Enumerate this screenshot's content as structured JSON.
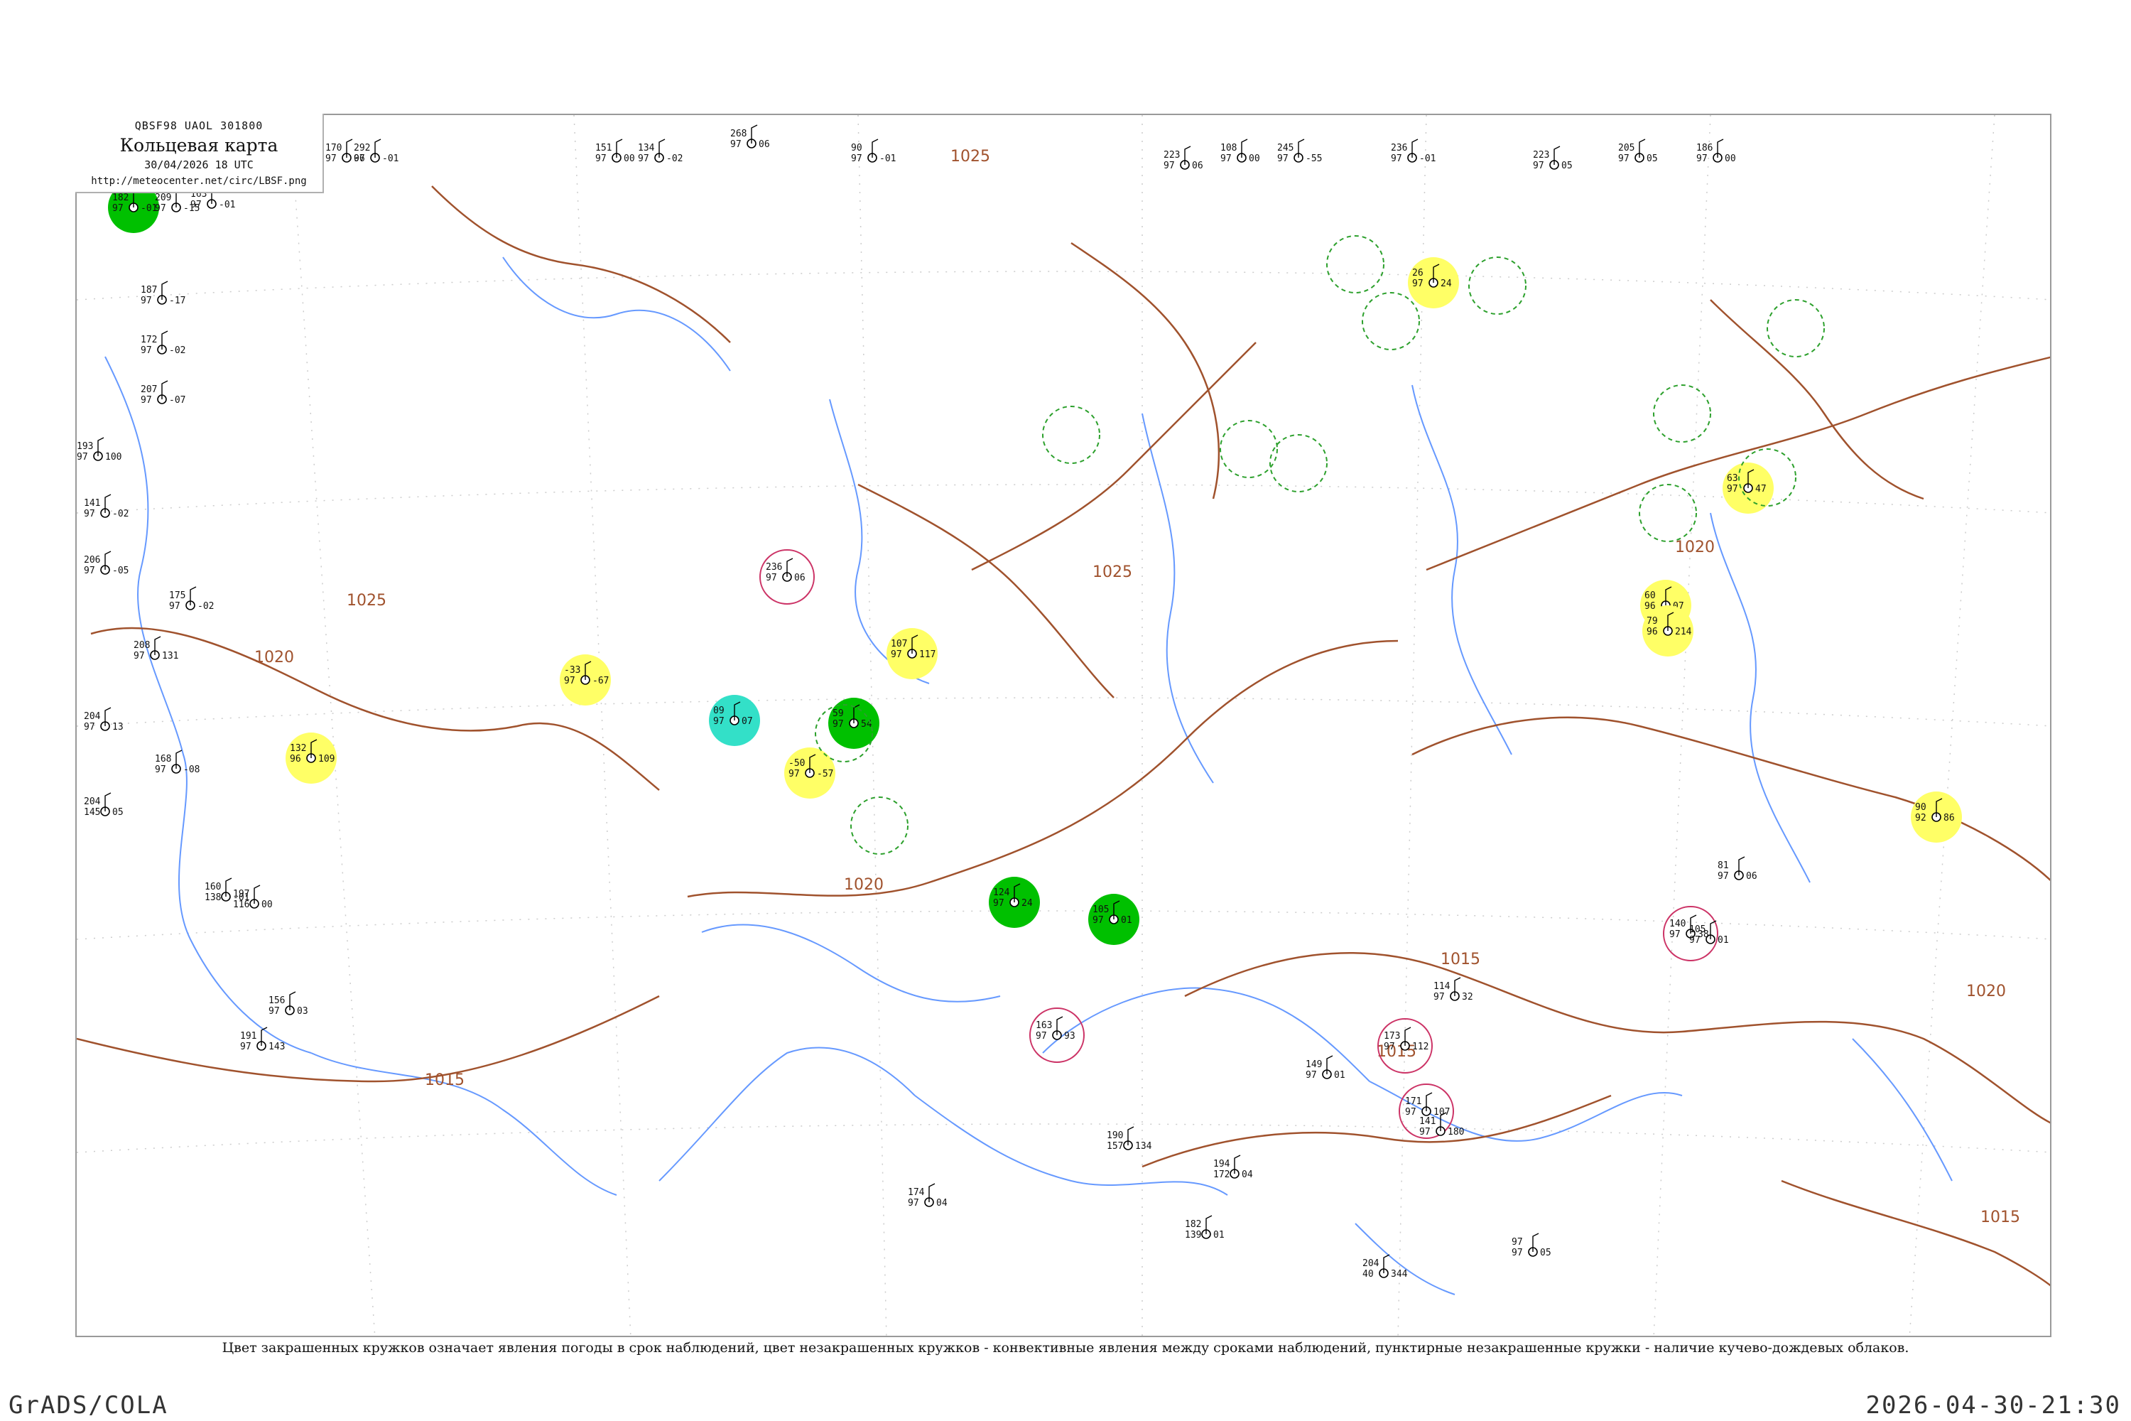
{
  "header": {
    "code": "QBSF98  UAOL  301800",
    "title": "Кольцевая карта",
    "datetime": "30/04/2026 18 UTC",
    "url": "http://meteocenter.net/circ/LBSF.png"
  },
  "isobars": [
    {
      "value": "1025"
    },
    {
      "value": "1025"
    },
    {
      "value": "1020"
    },
    {
      "value": "1015"
    },
    {
      "value": "1015"
    },
    {
      "value": "1020"
    },
    {
      "value": "1015"
    },
    {
      "value": "1020"
    },
    {
      "value": "1025"
    },
    {
      "value": "1015"
    },
    {
      "value": "1020"
    }
  ],
  "weather_colors": {
    "rain": "#00c000",
    "snow_mix": "#ffff66",
    "fog": "#33e0c8",
    "convective_ring": "#2ca02c",
    "thunder_ring": "#cc3366",
    "isobar": "#a0522d",
    "coastline": "#6699ff"
  },
  "stations": [
    {
      "t": "182",
      "p": "97",
      "v": "-01",
      "w": "rain"
    },
    {
      "t": "209",
      "p": "97",
      "v": "-15",
      "w": "none"
    },
    {
      "t": "163",
      "p": "97",
      "v": "-01",
      "w": "none"
    },
    {
      "t": "170",
      "p": "97",
      "v": "06",
      "w": "none"
    },
    {
      "t": "292",
      "p": "97",
      "v": "-01",
      "w": "none"
    },
    {
      "t": "151",
      "p": "97",
      "v": "00",
      "w": "none"
    },
    {
      "t": "134",
      "p": "97",
      "v": "-02",
      "w": "none"
    },
    {
      "t": "268",
      "p": "97",
      "v": "06",
      "w": "none"
    },
    {
      "t": "90",
      "p": "97",
      "v": "-01",
      "w": "none"
    },
    {
      "t": "223",
      "p": "97",
      "v": "06",
      "w": "none"
    },
    {
      "t": "108",
      "p": "97",
      "v": "00",
      "w": "none"
    },
    {
      "t": "245",
      "p": "97",
      "v": "-55",
      "w": "none"
    },
    {
      "t": "236",
      "p": "97",
      "v": "-01",
      "w": "none"
    },
    {
      "t": "223",
      "p": "97",
      "v": "05",
      "w": "none"
    },
    {
      "t": "205",
      "p": "97",
      "v": "05",
      "w": "none"
    },
    {
      "t": "186",
      "p": "97",
      "v": "00",
      "w": "none"
    },
    {
      "t": "187",
      "p": "97",
      "v": "-17",
      "w": "none"
    },
    {
      "t": "172",
      "p": "97",
      "v": "-02",
      "w": "none"
    },
    {
      "t": "207",
      "p": "97",
      "v": "-07",
      "w": "none"
    },
    {
      "t": "193",
      "p": "97",
      "v": "100",
      "w": "none"
    },
    {
      "t": "141",
      "p": "97",
      "v": "-02",
      "w": "none"
    },
    {
      "t": "206",
      "p": "97",
      "v": "-05",
      "w": "none"
    },
    {
      "t": "175",
      "p": "97",
      "v": "-02",
      "w": "none"
    },
    {
      "t": "208",
      "p": "97",
      "v": "131",
      "w": "none"
    },
    {
      "t": "204",
      "p": "97",
      "v": "13",
      "w": "none"
    },
    {
      "t": "168",
      "p": "97",
      "v": "-08",
      "w": "none"
    },
    {
      "t": "204",
      "p": "145",
      "v": "05",
      "w": "none"
    },
    {
      "t": "160",
      "p": "138",
      "v": "-01",
      "w": "none"
    },
    {
      "t": "197",
      "p": "116",
      "v": "00",
      "w": "none"
    },
    {
      "t": "156",
      "p": "97",
      "v": "03",
      "w": "none"
    },
    {
      "t": "191",
      "p": "97",
      "v": "143",
      "w": "none"
    },
    {
      "t": "132",
      "p": "96",
      "v": "109",
      "w": "snow_mix"
    },
    {
      "t": "-33",
      "p": "97",
      "v": "-67",
      "w": "snow_mix"
    },
    {
      "t": "107",
      "p": "97",
      "v": "117",
      "w": "snow_mix"
    },
    {
      "t": "-50",
      "p": "97",
      "v": "-57",
      "w": "snow_mix"
    },
    {
      "t": "26",
      "p": "97",
      "v": "24",
      "w": "snow_mix"
    },
    {
      "t": "60",
      "p": "96",
      "v": "07",
      "w": "snow_mix"
    },
    {
      "t": "79",
      "p": "96",
      "v": "214",
      "w": "snow_mix"
    },
    {
      "t": "63",
      "p": "97",
      "v": "47",
      "w": "snow_mix"
    },
    {
      "t": "90",
      "p": "92",
      "v": "86",
      "w": "snow_mix"
    },
    {
      "t": "09",
      "p": "97",
      "v": "07",
      "w": "fog"
    },
    {
      "t": "59",
      "p": "97",
      "v": "54",
      "w": "rain"
    },
    {
      "t": "124",
      "p": "97",
      "v": "24",
      "w": "rain"
    },
    {
      "t": "105",
      "p": "97",
      "v": "01",
      "w": "rain"
    },
    {
      "t": "236",
      "p": "97",
      "v": "06",
      "w": "thunder"
    },
    {
      "t": "163",
      "p": "97",
      "v": "93",
      "w": "thunder"
    },
    {
      "t": "171",
      "p": "97",
      "v": "107",
      "w": "thunder"
    },
    {
      "t": "173",
      "p": "97",
      "v": "112",
      "w": "thunder"
    },
    {
      "t": "140",
      "p": "97",
      "v": "38",
      "w": "thunder"
    },
    {
      "t": "97",
      "p": "97",
      "v": "05",
      "w": "none"
    },
    {
      "t": "204",
      "p": "40",
      "v": "344",
      "w": "none"
    },
    {
      "t": "182",
      "p": "139",
      "v": "01",
      "w": "none"
    },
    {
      "t": "194",
      "p": "172",
      "v": "04",
      "w": "none"
    },
    {
      "t": "190",
      "p": "157",
      "v": "134",
      "w": "none"
    },
    {
      "t": "174",
      "p": "97",
      "v": "04",
      "w": "none"
    },
    {
      "t": "81",
      "p": "97",
      "v": "06",
      "w": "none"
    },
    {
      "t": "105",
      "p": "97",
      "v": "01",
      "w": "none"
    },
    {
      "t": "114",
      "p": "97",
      "v": "32",
      "w": "none"
    },
    {
      "t": "149",
      "p": "97",
      "v": "01",
      "w": "none"
    },
    {
      "t": "141",
      "p": "97",
      "v": "180",
      "w": "none"
    }
  ],
  "caption": "Цвет закрашенных кружков означает явления погоды в срок наблюдений, цвет незакрашенных кружков - конвективные явления между сроками наблюдений, пунктирные незакрашенные кружки - наличие кучево-дождевых облаков.",
  "footer": {
    "left": "GrADS/COLA",
    "right": "2026-04-30-21:30"
  }
}
